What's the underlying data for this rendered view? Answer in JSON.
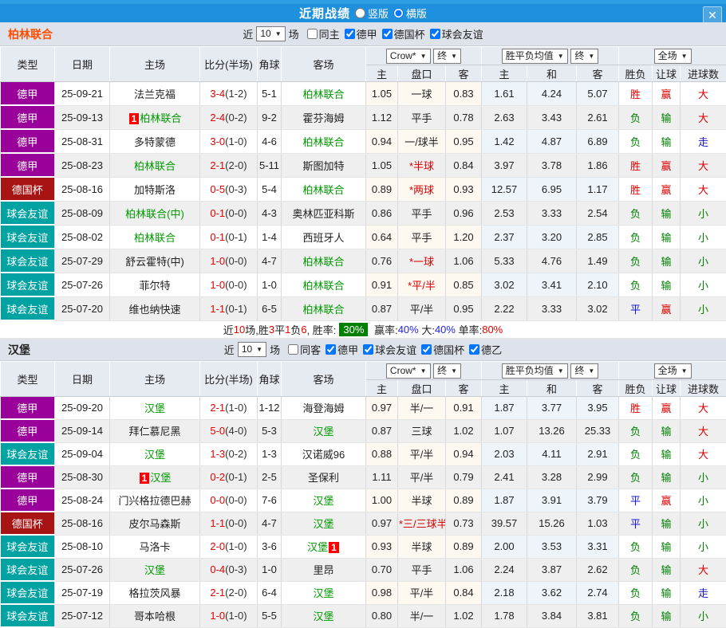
{
  "titlebar": {
    "title": "近期战绩",
    "radio_vertical": "竖版",
    "radio_horizontal": "横版",
    "selected": "横版",
    "close_label": "X"
  },
  "table_header": {
    "type": "类型",
    "date": "日期",
    "home": "主场",
    "score": "比分(半场)",
    "corner": "角球",
    "away": "客场",
    "dd_crow": "Crow*",
    "dd_final": "终",
    "dd_avg": "胜平负均值",
    "dd_scope": "全场",
    "sub_home": "主",
    "sub_handicap": "盘口",
    "sub_away": "客",
    "sub_avg_home": "主",
    "sub_avg_draw": "和",
    "sub_avg_away": "客",
    "sub_result": "胜负",
    "sub_handicap_result": "让球",
    "sub_goals": "进球数"
  },
  "league_colors": {
    "德甲": "#9A009A",
    "德国杯": "#A81414",
    "球会友谊": "#00A2A2"
  },
  "team_colors": {
    "section0": "#FF4E00",
    "section1": "#222222"
  },
  "sections": [
    {
      "team": "柏林联合",
      "filter": {
        "near": "近",
        "games": "10",
        "suffix": "场",
        "checkboxes": [
          {
            "label": "同主",
            "checked": false
          },
          {
            "label": "德甲",
            "checked": true
          },
          {
            "label": "德国杯",
            "checked": true
          },
          {
            "label": "球会友谊",
            "checked": true
          }
        ]
      },
      "rows": [
        {
          "league": "德甲",
          "date": "25-09-21",
          "home": {
            "text": "法兰克福"
          },
          "score": "3-4",
          "half": "(1-2)",
          "corner": "5-1",
          "away": {
            "text": "柏林联合",
            "green": true
          },
          "o1": "1.05",
          "hcap": "一球",
          "o2": "0.83",
          "a1": "1.61",
          "a2": "4.24",
          "a3": "5.07",
          "r": [
            "胜",
            "red"
          ],
          "h": [
            "赢",
            "red"
          ],
          "g": [
            "大",
            "red"
          ]
        },
        {
          "league": "德甲",
          "date": "25-09-13",
          "home": {
            "text": "柏林联合",
            "green": true,
            "badge_before": "1"
          },
          "score": "2-4",
          "half": "(0-2)",
          "corner": "9-2",
          "away": {
            "text": "霍芬海姆"
          },
          "o1": "1.12",
          "hcap": "平手",
          "o2": "0.78",
          "a1": "2.63",
          "a2": "3.43",
          "a3": "2.61",
          "r": [
            "负",
            "green"
          ],
          "h": [
            "输",
            "green"
          ],
          "g": [
            "大",
            "red"
          ]
        },
        {
          "league": "德甲",
          "date": "25-08-31",
          "home": {
            "text": "多特蒙德"
          },
          "score": "3-0",
          "half": "(1-0)",
          "corner": "4-6",
          "away": {
            "text": "柏林联合",
            "green": true
          },
          "o1": "0.94",
          "hcap": "一/球半",
          "o2": "0.95",
          "a1": "1.42",
          "a2": "4.87",
          "a3": "6.89",
          "r": [
            "负",
            "green"
          ],
          "h": [
            "输",
            "green"
          ],
          "g": [
            "走",
            "blue"
          ]
        },
        {
          "league": "德甲",
          "date": "25-08-23",
          "home": {
            "text": "柏林联合",
            "green": true
          },
          "score": "2-1",
          "half": "(2-0)",
          "corner": "5-11",
          "away": {
            "text": "斯图加特"
          },
          "o1": "1.05",
          "hcap": "*半球",
          "o2": "0.84",
          "a1": "3.97",
          "a2": "3.78",
          "a3": "1.86",
          "r": [
            "胜",
            "red"
          ],
          "h": [
            "赢",
            "red"
          ],
          "g": [
            "大",
            "red"
          ]
        },
        {
          "league": "德国杯",
          "date": "25-08-16",
          "home": {
            "text": "加特斯洛"
          },
          "score": "0-5",
          "half": "(0-3)",
          "corner": "5-4",
          "away": {
            "text": "柏林联合",
            "green": true
          },
          "o1": "0.89",
          "hcap": "*两球",
          "o2": "0.93",
          "a1": "12.57",
          "a2": "6.95",
          "a3": "1.17",
          "r": [
            "胜",
            "red"
          ],
          "h": [
            "赢",
            "red"
          ],
          "g": [
            "大",
            "red"
          ]
        },
        {
          "league": "球会友谊",
          "date": "25-08-09",
          "home": {
            "text": "柏林联合(中)",
            "green": true
          },
          "score": "0-1",
          "half": "(0-0)",
          "corner": "4-3",
          "away": {
            "text": "奥林匹亚科斯"
          },
          "o1": "0.86",
          "hcap": "平手",
          "o2": "0.96",
          "a1": "2.53",
          "a2": "3.33",
          "a3": "2.54",
          "r": [
            "负",
            "green"
          ],
          "h": [
            "输",
            "green"
          ],
          "g": [
            "小",
            "green"
          ]
        },
        {
          "league": "球会友谊",
          "date": "25-08-02",
          "home": {
            "text": "柏林联合",
            "green": true
          },
          "score": "0-1",
          "half": "(0-1)",
          "corner": "1-4",
          "away": {
            "text": "西班牙人"
          },
          "o1": "0.64",
          "hcap": "平手",
          "o2": "1.20",
          "a1": "2.37",
          "a2": "3.20",
          "a3": "2.85",
          "r": [
            "负",
            "green"
          ],
          "h": [
            "输",
            "green"
          ],
          "g": [
            "小",
            "green"
          ]
        },
        {
          "league": "球会友谊",
          "date": "25-07-29",
          "home": {
            "text": "舒云霍特(中)"
          },
          "score": "1-0",
          "half": "(0-0)",
          "corner": "4-7",
          "away": {
            "text": "柏林联合",
            "green": true
          },
          "o1": "0.76",
          "hcap": "*一球",
          "o2": "1.06",
          "a1": "5.33",
          "a2": "4.76",
          "a3": "1.49",
          "r": [
            "负",
            "green"
          ],
          "h": [
            "输",
            "green"
          ],
          "g": [
            "小",
            "green"
          ]
        },
        {
          "league": "球会友谊",
          "date": "25-07-26",
          "home": {
            "text": "菲尔特"
          },
          "score": "1-0",
          "half": "(0-0)",
          "corner": "1-0",
          "away": {
            "text": "柏林联合",
            "green": true
          },
          "o1": "0.91",
          "hcap": "*平/半",
          "o2": "0.85",
          "a1": "3.02",
          "a2": "3.41",
          "a3": "2.10",
          "r": [
            "负",
            "green"
          ],
          "h": [
            "输",
            "green"
          ],
          "g": [
            "小",
            "green"
          ]
        },
        {
          "league": "球会友谊",
          "date": "25-07-20",
          "home": {
            "text": "维也纳快速"
          },
          "score": "1-1",
          "half": "(0-1)",
          "corner": "6-5",
          "away": {
            "text": "柏林联合",
            "green": true
          },
          "o1": "0.87",
          "hcap": "平/半",
          "o2": "0.95",
          "a1": "2.22",
          "a2": "3.33",
          "a3": "3.02",
          "r": [
            "平",
            "blue"
          ],
          "h": [
            "赢",
            "red"
          ],
          "g": [
            "小",
            "green"
          ]
        }
      ],
      "summary": {
        "segments": [
          {
            "t": "近",
            "c": "black"
          },
          {
            "t": "10",
            "c": "red"
          },
          {
            "t": "场,胜",
            "c": "black"
          },
          {
            "t": "3",
            "c": "red"
          },
          {
            "t": "平",
            "c": "black"
          },
          {
            "t": "1",
            "c": "red"
          },
          {
            "t": "负",
            "c": "black"
          },
          {
            "t": "6",
            "c": "red"
          },
          {
            "t": ", 胜率:",
            "c": "black"
          },
          {
            "t": "30%",
            "c": "badge"
          },
          {
            "t": " 赢率:",
            "c": "black"
          },
          {
            "t": "40%",
            "c": "blue"
          },
          {
            "t": " 大:",
            "c": "black"
          },
          {
            "t": "40%",
            "c": "blue"
          },
          {
            "t": " 单率:",
            "c": "black"
          },
          {
            "t": "80%",
            "c": "red"
          }
        ]
      }
    },
    {
      "team": "汉堡",
      "filter": {
        "near": "近",
        "games": "10",
        "suffix": "场",
        "checkboxes": [
          {
            "label": "同客",
            "checked": false
          },
          {
            "label": "德甲",
            "checked": true
          },
          {
            "label": "球会友谊",
            "checked": true
          },
          {
            "label": "德国杯",
            "checked": true
          },
          {
            "label": "德乙",
            "checked": true
          }
        ]
      },
      "rows": [
        {
          "league": "德甲",
          "date": "25-09-20",
          "home": {
            "text": "汉堡",
            "green": true
          },
          "score": "2-1",
          "half": "(1-0)",
          "corner": "1-12",
          "away": {
            "text": "海登海姆"
          },
          "o1": "0.97",
          "hcap": "半/一",
          "o2": "0.91",
          "a1": "1.87",
          "a2": "3.77",
          "a3": "3.95",
          "r": [
            "胜",
            "red"
          ],
          "h": [
            "赢",
            "red"
          ],
          "g": [
            "大",
            "red"
          ]
        },
        {
          "league": "德甲",
          "date": "25-09-14",
          "home": {
            "text": "拜仁慕尼黑"
          },
          "score": "5-0",
          "half": "(4-0)",
          "corner": "5-3",
          "away": {
            "text": "汉堡",
            "green": true
          },
          "o1": "0.87",
          "hcap": "三球",
          "o2": "1.02",
          "a1": "1.07",
          "a2": "13.26",
          "a3": "25.33",
          "r": [
            "负",
            "green"
          ],
          "h": [
            "输",
            "green"
          ],
          "g": [
            "大",
            "red"
          ]
        },
        {
          "league": "球会友谊",
          "date": "25-09-04",
          "home": {
            "text": "汉堡",
            "green": true
          },
          "score": "1-3",
          "half": "(0-2)",
          "corner": "1-3",
          "away": {
            "text": "汉诺威96"
          },
          "o1": "0.88",
          "hcap": "平/半",
          "o2": "0.94",
          "a1": "2.03",
          "a2": "4.11",
          "a3": "2.91",
          "r": [
            "负",
            "green"
          ],
          "h": [
            "输",
            "green"
          ],
          "g": [
            "大",
            "red"
          ]
        },
        {
          "league": "德甲",
          "date": "25-08-30",
          "home": {
            "text": "汉堡",
            "green": true,
            "badge_before": "1"
          },
          "score": "0-2",
          "half": "(0-1)",
          "corner": "2-5",
          "away": {
            "text": "圣保利"
          },
          "o1": "1.11",
          "hcap": "平/半",
          "o2": "0.79",
          "a1": "2.41",
          "a2": "3.28",
          "a3": "2.99",
          "r": [
            "负",
            "green"
          ],
          "h": [
            "输",
            "green"
          ],
          "g": [
            "小",
            "green"
          ]
        },
        {
          "league": "德甲",
          "date": "25-08-24",
          "home": {
            "text": "门兴格拉德巴赫"
          },
          "score": "0-0",
          "half": "(0-0)",
          "corner": "7-6",
          "away": {
            "text": "汉堡",
            "green": true
          },
          "o1": "1.00",
          "hcap": "半球",
          "o2": "0.89",
          "a1": "1.87",
          "a2": "3.91",
          "a3": "3.79",
          "r": [
            "平",
            "blue"
          ],
          "h": [
            "赢",
            "red"
          ],
          "g": [
            "小",
            "green"
          ]
        },
        {
          "league": "德国杯",
          "date": "25-08-16",
          "home": {
            "text": "皮尔马森斯"
          },
          "score": "1-1",
          "half": "(0-0)",
          "corner": "4-7",
          "away": {
            "text": "汉堡",
            "green": true
          },
          "o1": "0.97",
          "hcap": "*三/三球半",
          "o2": "0.73",
          "a1": "39.57",
          "a2": "15.26",
          "a3": "1.03",
          "r": [
            "平",
            "blue"
          ],
          "h": [
            "输",
            "green"
          ],
          "g": [
            "小",
            "green"
          ]
        },
        {
          "league": "球会友谊",
          "date": "25-08-10",
          "home": {
            "text": "马洛卡"
          },
          "score": "2-0",
          "half": "(1-0)",
          "corner": "3-6",
          "away": {
            "text": "汉堡",
            "green": true,
            "badge_after": "1"
          },
          "o1": "0.93",
          "hcap": "半球",
          "o2": "0.89",
          "a1": "2.00",
          "a2": "3.53",
          "a3": "3.31",
          "r": [
            "负",
            "green"
          ],
          "h": [
            "输",
            "green"
          ],
          "g": [
            "小",
            "green"
          ]
        },
        {
          "league": "球会友谊",
          "date": "25-07-26",
          "home": {
            "text": "汉堡",
            "green": true
          },
          "score": "0-4",
          "half": "(0-3)",
          "corner": "1-0",
          "away": {
            "text": "里昂"
          },
          "o1": "0.70",
          "hcap": "平手",
          "o2": "1.06",
          "a1": "2.24",
          "a2": "3.87",
          "a3": "2.62",
          "r": [
            "负",
            "green"
          ],
          "h": [
            "输",
            "green"
          ],
          "g": [
            "大",
            "red"
          ]
        },
        {
          "league": "球会友谊",
          "date": "25-07-19",
          "home": {
            "text": "格拉茨风暴"
          },
          "score": "2-1",
          "half": "(2-0)",
          "corner": "6-4",
          "away": {
            "text": "汉堡",
            "green": true
          },
          "o1": "0.98",
          "hcap": "平/半",
          "o2": "0.84",
          "a1": "2.18",
          "a2": "3.62",
          "a3": "2.74",
          "r": [
            "负",
            "green"
          ],
          "h": [
            "输",
            "green"
          ],
          "g": [
            "走",
            "blue"
          ]
        },
        {
          "league": "球会友谊",
          "date": "25-07-12",
          "home": {
            "text": "哥本哈根"
          },
          "score": "1-0",
          "half": "(1-0)",
          "corner": "5-5",
          "away": {
            "text": "汉堡",
            "green": true
          },
          "o1": "0.80",
          "hcap": "半/一",
          "o2": "1.02",
          "a1": "1.78",
          "a2": "3.84",
          "a3": "3.81",
          "r": [
            "负",
            "green"
          ],
          "h": [
            "输",
            "green"
          ],
          "g": [
            "小",
            "green"
          ]
        }
      ]
    }
  ]
}
